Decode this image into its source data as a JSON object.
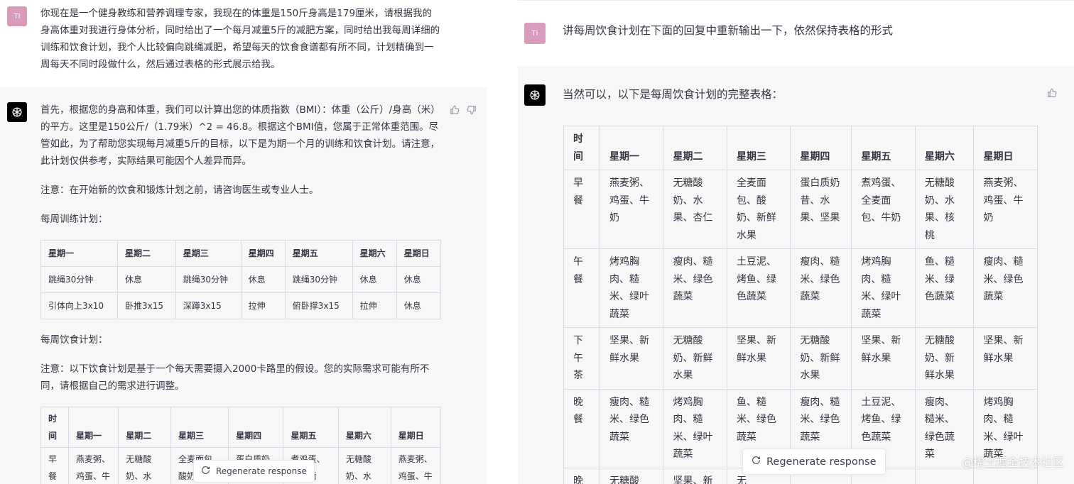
{
  "left": {
    "user_avatar": "TI",
    "user_message": "你现在是一个健身教练和营养调理专家，我现在的体重是150斤身高是179厘米，请根据我的身高体重对我进行身体分析，同时给出了一个每月减重5斤的减肥方案，同时给出我每周详细的训练和饮食计划，我个人比较偏向跳绳减肥，希望每天的饮食食谱都有所不同，计划精确到一周每天不同时段做什么，然后通过表格的形式展示给我。",
    "bot_p1": "首先，根据您的身高和体重，我们可以计算出您的体质指数（BMI）：体重（公斤）/身高（米）的平方。这里是150公斤/（1.79米）^2 = 46.8。根据这个BMI值，您属于正常体重范围。尽管如此，为了帮助您实现每月减重5斤的目标，以下是为期一个月的训练和饮食计划。请注意，此计划仅供参考，实际结果可能因个人差异而异。",
    "bot_p2": "注意：在开始新的饮食和锻炼计划之前，请咨询医生或专业人士。",
    "bot_p3": "每周训练计划：",
    "training": {
      "headers": [
        "星期一",
        "星期二",
        "星期三",
        "星期四",
        "星期五",
        "星期六",
        "星期日"
      ],
      "rows": [
        [
          "跳绳30分钟",
          "休息",
          "跳绳30分钟",
          "休息",
          "跳绳30分钟",
          "休息",
          "休息"
        ],
        [
          "引体向上3x10",
          "卧推3x15",
          "深蹲3x15",
          "拉伸",
          "俯卧撑3x15",
          "拉伸",
          "休息"
        ]
      ]
    },
    "bot_p4": "每周饮食计划：",
    "bot_p5": "注意：以下饮食计划是基于一个每天需要摄入2000卡路里的假设。您的实际需求可能有所不同，请根据自己的需求进行调整。",
    "diet": {
      "headers": [
        "时间",
        "星期一",
        "星期二",
        "星期三",
        "星期四",
        "星期五",
        "星期六",
        "星期日"
      ],
      "rows": [
        [
          "早餐",
          "燕麦粥、鸡蛋、牛奶",
          "无糖酸奶、水果、杏仁",
          "全麦面包、酸奶、新鲜水果",
          "蛋白质奶昔、水果、坚果",
          "煮鸡蛋、全麦面包、牛奶",
          "无糖酸奶、水果、核桃",
          "燕麦粥、鸡蛋、牛奶"
        ]
      ]
    },
    "regen_label": "Regenerate response"
  },
  "right": {
    "user_avatar": "TI",
    "user_message": "讲每周饮食计划在下面的回复中重新输出一下，依然保持表格的形式",
    "bot_intro": "当然可以，以下是每周饮食计划的完整表格：",
    "diet": {
      "headers": [
        "时间",
        "星期一",
        "星期二",
        "星期三",
        "星期四",
        "星期五",
        "星期六",
        "星期日"
      ],
      "rows": [
        [
          "早餐",
          "燕麦粥、鸡蛋、牛奶",
          "无糖酸奶、水果、杏仁",
          "全麦面包、酸奶、新鲜水果",
          "蛋白质奶昔、水果、坚果",
          "煮鸡蛋、全麦面包、牛奶",
          "无糖酸奶、水果、核桃",
          "燕麦粥、鸡蛋、牛奶"
        ],
        [
          "午餐",
          "烤鸡胸肉、糙米、绿叶蔬菜",
          "瘦肉、糙米、绿色蔬菜",
          "土豆泥、烤鱼、绿色蔬菜",
          "瘦肉、糙米、绿色蔬菜",
          "烤鸡胸肉、糙米、绿叶蔬菜",
          "鱼、糙米、绿色蔬菜",
          "瘦肉、糙米、绿色蔬菜"
        ],
        [
          "下午茶",
          "坚果、新鲜水果",
          "无糖酸奶、新鲜水果",
          "坚果、新鲜水果",
          "无糖酸奶、新鲜水果",
          "坚果、新鲜水果",
          "无糖酸奶、新鲜水果",
          "坚果、新鲜水果"
        ],
        [
          "晚餐",
          "瘦肉、糙米、绿色蔬菜",
          "烤鸡胸肉、糙米、绿叶蔬菜",
          "鱼、糙米、绿色蔬菜",
          "瘦肉、糙米、绿色蔬菜",
          "土豆泥、烤鱼、绿色蔬菜",
          "瘦肉、糙米、绿色蔬菜",
          "烤鸡胸肉、糙米、绿叶蔬菜"
        ],
        [
          "晚",
          "无糖酸",
          "坚果、新",
          "无",
          "",
          "",
          "",
          ""
        ]
      ]
    },
    "regen_label": "Regenerate response"
  },
  "watermark": "@稀土掘金技术社区"
}
